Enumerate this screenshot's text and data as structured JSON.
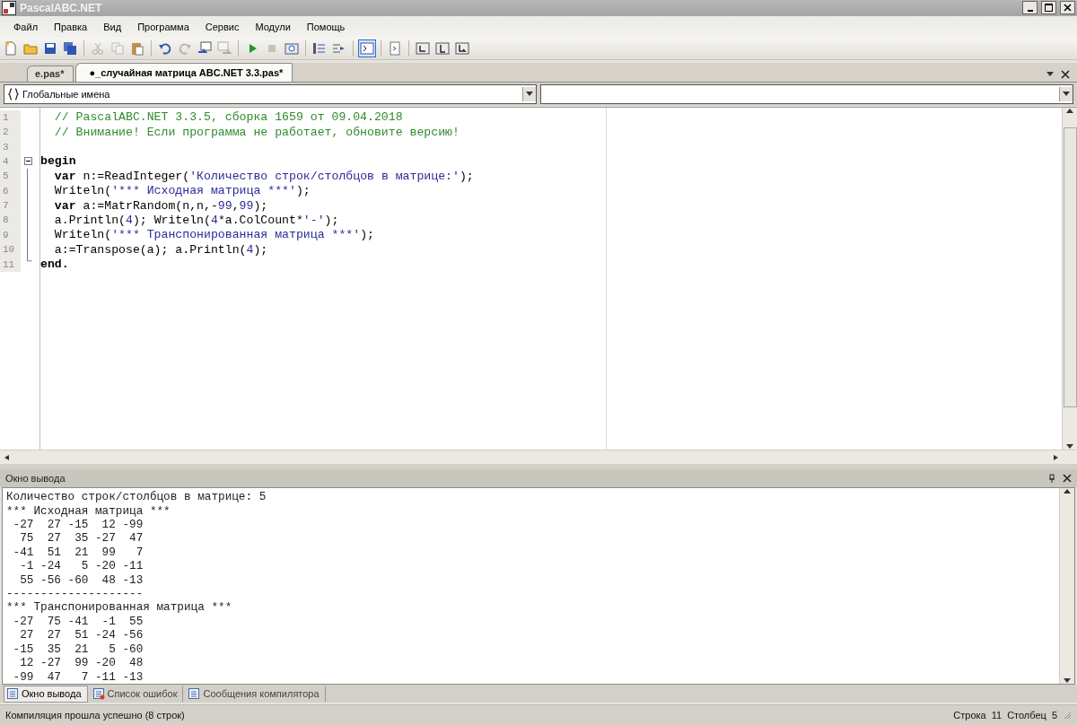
{
  "window": {
    "title": "PascalABC.NET"
  },
  "menu": [
    "Файл",
    "Правка",
    "Вид",
    "Программа",
    "Сервис",
    "Модули",
    "Помощь"
  ],
  "toolbar": [
    {
      "disabled": false,
      "pressed": false
    },
    {
      "disabled": false,
      "pressed": false
    },
    {
      "disabled": false,
      "pressed": false
    },
    {
      "disabled": false,
      "pressed": false
    },
    {
      "disabled": true,
      "pressed": false
    },
    {
      "disabled": true,
      "pressed": false
    },
    {
      "disabled": false,
      "pressed": false
    },
    {
      "disabled": false,
      "pressed": false
    },
    {
      "disabled": true,
      "pressed": false
    },
    {
      "disabled": false,
      "pressed": false
    },
    {
      "disabled": true,
      "pressed": false
    },
    {
      "disabled": false,
      "pressed": false
    },
    {
      "disabled": true,
      "pressed": false
    },
    {
      "disabled": false,
      "pressed": false
    },
    {
      "disabled": false,
      "pressed": false
    },
    {
      "disabled": false,
      "pressed": false
    },
    {
      "disabled": false,
      "pressed": true
    },
    {
      "disabled": false,
      "pressed": false
    },
    {
      "disabled": false,
      "pressed": false
    },
    {
      "disabled": false,
      "pressed": false
    },
    {
      "disabled": false,
      "pressed": false
    }
  ],
  "tabs": [
    {
      "label": "e.pas*",
      "selected": false
    },
    {
      "label": "●_случайная матрица ABC.NET 3.3.pas*",
      "selected": true
    }
  ],
  "scope_select": {
    "value": "Глобальные имена"
  },
  "editor": {
    "lines": [
      {
        "number": "1",
        "kind": "comment",
        "segments": [
          {
            "kind": "comment",
            "text": "  // PascalABC.NET 3.3.5, сборка 1659 от 09.04.2018"
          }
        ]
      },
      {
        "number": "2",
        "kind": "comment",
        "segments": [
          {
            "kind": "comment",
            "text": "  // Внимание! Если программа не работает, обновите версию!"
          }
        ]
      },
      {
        "number": "3",
        "kind": "blank"
      },
      {
        "number": "4",
        "kind": "fold",
        "segments": [
          {
            "kind": "keyword",
            "text": "begin"
          }
        ]
      },
      {
        "number": "5",
        "kind": "body",
        "segments": [
          {
            "kind": "keyword",
            "text": "  var"
          },
          {
            "kind": "plain",
            "text": " n:=ReadInteger("
          },
          {
            "kind": "string",
            "text": "'Количество строк/столбцов в матрице:'"
          },
          {
            "kind": "plain",
            "text": ");"
          }
        ]
      },
      {
        "number": "6",
        "kind": "body",
        "segments": [
          {
            "kind": "plain",
            "text": "  Writeln("
          },
          {
            "kind": "string",
            "text": "'*** Исходная матрица ***'"
          },
          {
            "kind": "plain",
            "text": ");"
          }
        ]
      },
      {
        "number": "7",
        "kind": "body",
        "segments": [
          {
            "kind": "keyword",
            "text": "  var"
          },
          {
            "kind": "plain",
            "text": " a:=MatrRandom(n,n,-"
          },
          {
            "kind": "number",
            "text": "99"
          },
          {
            "kind": "plain",
            "text": ","
          },
          {
            "kind": "number",
            "text": "99"
          },
          {
            "kind": "plain",
            "text": ");"
          }
        ]
      },
      {
        "number": "8",
        "kind": "body",
        "segments": [
          {
            "kind": "plain",
            "text": "  a.Println("
          },
          {
            "kind": "number",
            "text": "4"
          },
          {
            "kind": "plain",
            "text": "); Writeln("
          },
          {
            "kind": "number",
            "text": "4"
          },
          {
            "kind": "plain",
            "text": "*a.ColCount*"
          },
          {
            "kind": "string",
            "text": "'-'"
          },
          {
            "kind": "plain",
            "text": ");"
          }
        ]
      },
      {
        "number": "9",
        "kind": "body",
        "segments": [
          {
            "kind": "plain",
            "text": "  Writeln("
          },
          {
            "kind": "string",
            "text": "'*** Транспонированная матрица ***'"
          },
          {
            "kind": "plain",
            "text": ");"
          }
        ]
      },
      {
        "number": "10",
        "kind": "body",
        "segments": [
          {
            "kind": "plain",
            "text": "  a:=Transpose(a); a.Println("
          },
          {
            "kind": "number",
            "text": "4"
          },
          {
            "kind": "plain",
            "text": ");"
          }
        ]
      },
      {
        "number": "11",
        "kind": "end",
        "segments": [
          {
            "kind": "keyword",
            "text": "end."
          }
        ]
      }
    ]
  },
  "output": {
    "title": "Окно вывода",
    "lines": [
      "Количество строк/столбцов в матрице: 5",
      "*** Исходная матрица ***",
      " -27  27 -15  12 -99",
      "  75  27  35 -27  47",
      " -41  51  21  99   7",
      "  -1 -24   5 -20 -11",
      "  55 -56 -60  48 -13",
      "--------------------",
      "*** Транспонированная матрица ***",
      " -27  75 -41  -1  55",
      "  27  27  51 -24 -56",
      " -15  35  21   5 -60",
      "  12 -27  99 -20  48",
      " -99  47   7 -11 -13"
    ]
  },
  "bottom_tabs": [
    {
      "label": "Окно вывода",
      "selected": true
    },
    {
      "label": "Список ошибок",
      "selected": false
    },
    {
      "label": "Сообщения компилятора",
      "selected": false
    }
  ],
  "status_bar": {
    "message": "Компиляция прошла успешно (8 строк)",
    "line_label": "Строка",
    "line": "11",
    "column_label": "Столбец",
    "column": "5"
  }
}
